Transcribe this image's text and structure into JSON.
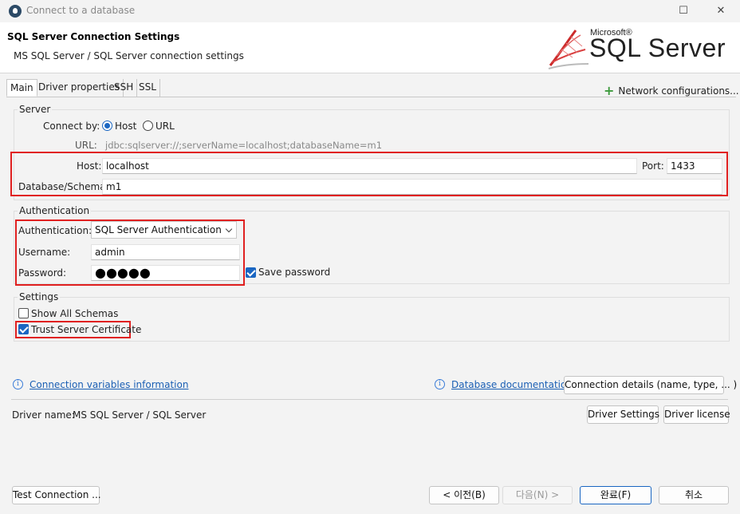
{
  "window": {
    "title": "Connect to a database",
    "minimize_glyph": "☐",
    "close_glyph": "✕"
  },
  "header": {
    "title": "SQL Server Connection Settings",
    "subtitle": "MS SQL Server / SQL Server connection settings",
    "logo_microsoft": "Microsoft®",
    "logo_product": "SQL Server"
  },
  "tabs": [
    {
      "label": "Main",
      "active": true
    },
    {
      "label": "Driver properties"
    },
    {
      "label": "SSH"
    },
    {
      "label": "SSL"
    }
  ],
  "network_config": {
    "label": "Network configurations..."
  },
  "server": {
    "group_title": "Server",
    "connect_by_label": "Connect by:",
    "host_option": "Host",
    "url_option": "URL",
    "connect_by_selected": "Host",
    "url_label": "URL:",
    "url_value": "jdbc:sqlserver://;serverName=localhost;databaseName=m1",
    "host_label": "Host:",
    "host_value": "localhost",
    "port_label": "Port:",
    "port_value": "1433",
    "database_label": "Database/Schema:",
    "database_value": "m1"
  },
  "authentication": {
    "group_title": "Authentication",
    "auth_label": "Authentication:",
    "auth_value": "SQL Server Authentication",
    "username_label": "Username:",
    "username_value": "admin",
    "password_label": "Password:",
    "password_value": "●●●●●",
    "save_password_label": "Save password",
    "save_password_checked": true
  },
  "settings": {
    "group_title": "Settings",
    "show_all_schemas_label": "Show All Schemas",
    "show_all_schemas_checked": false,
    "trust_cert_label": "Trust Server Certificate",
    "trust_cert_checked": true
  },
  "links": {
    "info_glyph": "i",
    "connection_variables": "Connection variables information",
    "database_documentation": "Database documentation"
  },
  "connection_details_button": "Connection details (name, type, ... )",
  "driver": {
    "label": "Driver name:",
    "value": "MS SQL Server / SQL Server",
    "settings_button": "Driver Settings",
    "license_button": "Driver license"
  },
  "footer": {
    "test_connection": "Test Connection ...",
    "back": "< 이전(B)",
    "next": "다음(N) >",
    "finish": "완료(F)",
    "cancel": "취소"
  },
  "colors": {
    "highlight": "#e02020",
    "accent": "#1a66c2",
    "link": "#1a5fb4"
  }
}
